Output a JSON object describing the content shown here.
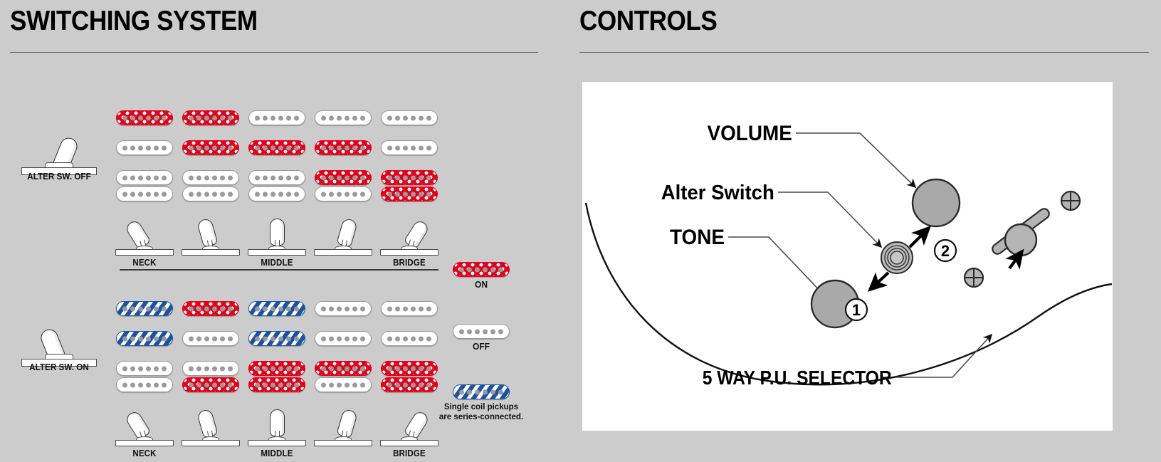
{
  "page": {
    "background": "#cccccc",
    "panel_bg": "#ffffff"
  },
  "colors": {
    "pickup_on": "#e2001a",
    "pickup_off": "#ffffff",
    "pickup_series": "#1b52a4",
    "pole_piece": "#9a9a9a",
    "rule": "#5a5a5a",
    "knob_fill": "#a9a9a9"
  },
  "switching": {
    "title": "SWITCHING SYSTEM",
    "position_labels": [
      "NECK",
      "",
      "MIDDLE",
      "",
      "BRIDGE"
    ],
    "groups": [
      {
        "id": "alter-off",
        "alter_label": "ALTER SW. OFF",
        "alter_state": "off",
        "rows": [
          {
            "type": "single",
            "name": "neck-single"
          },
          {
            "type": "single",
            "name": "middle-single"
          },
          {
            "type": "humbucker",
            "name": "bridge-humbucker"
          }
        ],
        "matrix": [
          [
            [
              "on"
            ],
            [
              "on"
            ],
            [
              "off"
            ],
            [
              "off"
            ],
            [
              "off"
            ]
          ],
          [
            [
              "off"
            ],
            [
              "on"
            ],
            [
              "on"
            ],
            [
              "on"
            ],
            [
              "off"
            ]
          ],
          [
            [
              "off",
              "off"
            ],
            [
              "off",
              "off"
            ],
            [
              "off",
              "off"
            ],
            [
              "on",
              "off"
            ],
            [
              "on",
              "on"
            ]
          ]
        ],
        "lever_tilt": [
          -32,
          -16,
          0,
          16,
          32
        ]
      },
      {
        "id": "alter-on",
        "alter_label": "ALTER SW. ON",
        "alter_state": "on",
        "rows": [
          {
            "type": "single",
            "name": "neck-single"
          },
          {
            "type": "single",
            "name": "middle-single"
          },
          {
            "type": "humbucker",
            "name": "bridge-humbucker"
          }
        ],
        "matrix": [
          [
            [
              "series"
            ],
            [
              "on"
            ],
            [
              "series"
            ],
            [
              "off"
            ],
            [
              "off"
            ]
          ],
          [
            [
              "series"
            ],
            [
              "off"
            ],
            [
              "series"
            ],
            [
              "off"
            ],
            [
              "off"
            ]
          ],
          [
            [
              "off",
              "off"
            ],
            [
              "off",
              "on"
            ],
            [
              "on",
              "on"
            ],
            [
              "on",
              "off"
            ],
            [
              "on",
              "on"
            ]
          ]
        ],
        "lever_tilt": [
          -32,
          -16,
          0,
          16,
          32
        ]
      }
    ],
    "legend": [
      {
        "state": "on",
        "label": "ON"
      },
      {
        "state": "off",
        "label": "OFF"
      }
    ],
    "legend_note": {
      "state": "series",
      "line1": "Single coil pickups",
      "line2": "are series-connected."
    }
  },
  "controls": {
    "title": "CONTROLS",
    "labels": {
      "volume": "VOLUME",
      "alter_switch": "Alter Switch",
      "tone": "TONE",
      "selector": "5 WAY P.U. SELECTOR"
    },
    "switch_positions": [
      {
        "number": "1",
        "glyph": "①"
      },
      {
        "number": "2",
        "glyph": "②"
      }
    ]
  }
}
